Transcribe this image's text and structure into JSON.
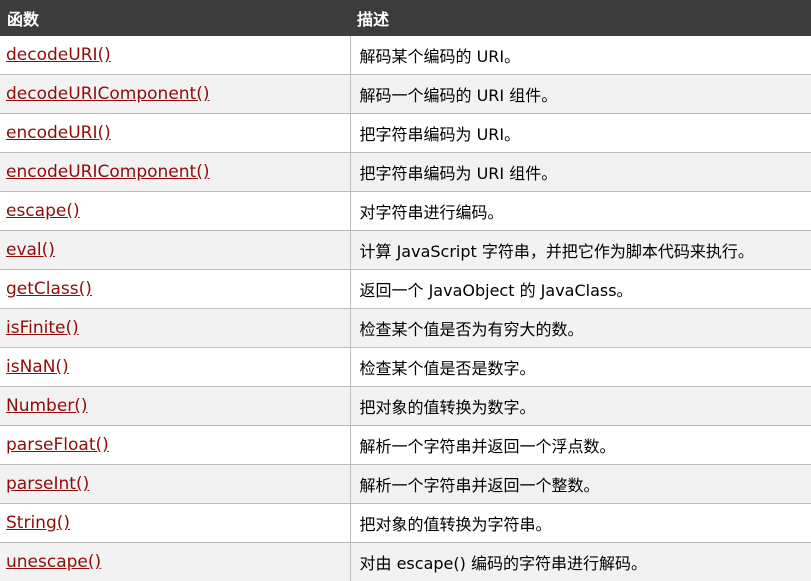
{
  "header": {
    "col_function": "函数",
    "col_description": "描述"
  },
  "rows": [
    {
      "fn": "decodeURI()",
      "desc": "解码某个编码的 URI。"
    },
    {
      "fn": "decodeURIComponent()",
      "desc": "解码一个编码的 URI 组件。"
    },
    {
      "fn": "encodeURI()",
      "desc": "把字符串编码为 URI。"
    },
    {
      "fn": "encodeURIComponent()",
      "desc": "把字符串编码为 URI 组件。"
    },
    {
      "fn": "escape()",
      "desc": "对字符串进行编码。"
    },
    {
      "fn": "eval()",
      "desc": "计算 JavaScript 字符串，并把它作为脚本代码来执行。"
    },
    {
      "fn": "getClass()",
      "desc": "返回一个 JavaObject 的 JavaClass。"
    },
    {
      "fn": "isFinite()",
      "desc": "检查某个值是否为有穷大的数。"
    },
    {
      "fn": "isNaN()",
      "desc": "检查某个值是否是数字。"
    },
    {
      "fn": "Number()",
      "desc": "把对象的值转换为数字。"
    },
    {
      "fn": "parseFloat()",
      "desc": "解析一个字符串并返回一个浮点数。"
    },
    {
      "fn": "parseInt()",
      "desc": "解析一个字符串并返回一个整数。"
    },
    {
      "fn": "String()",
      "desc": "把对象的值转换为字符串。"
    },
    {
      "fn": "unescape()",
      "desc": "对由 escape() 编码的字符串进行解码。"
    }
  ],
  "colors": {
    "header_bg": "#3c3c3c",
    "link": "#900b09",
    "row_alt": "#f2f2f2",
    "border": "#bdbdbd"
  }
}
